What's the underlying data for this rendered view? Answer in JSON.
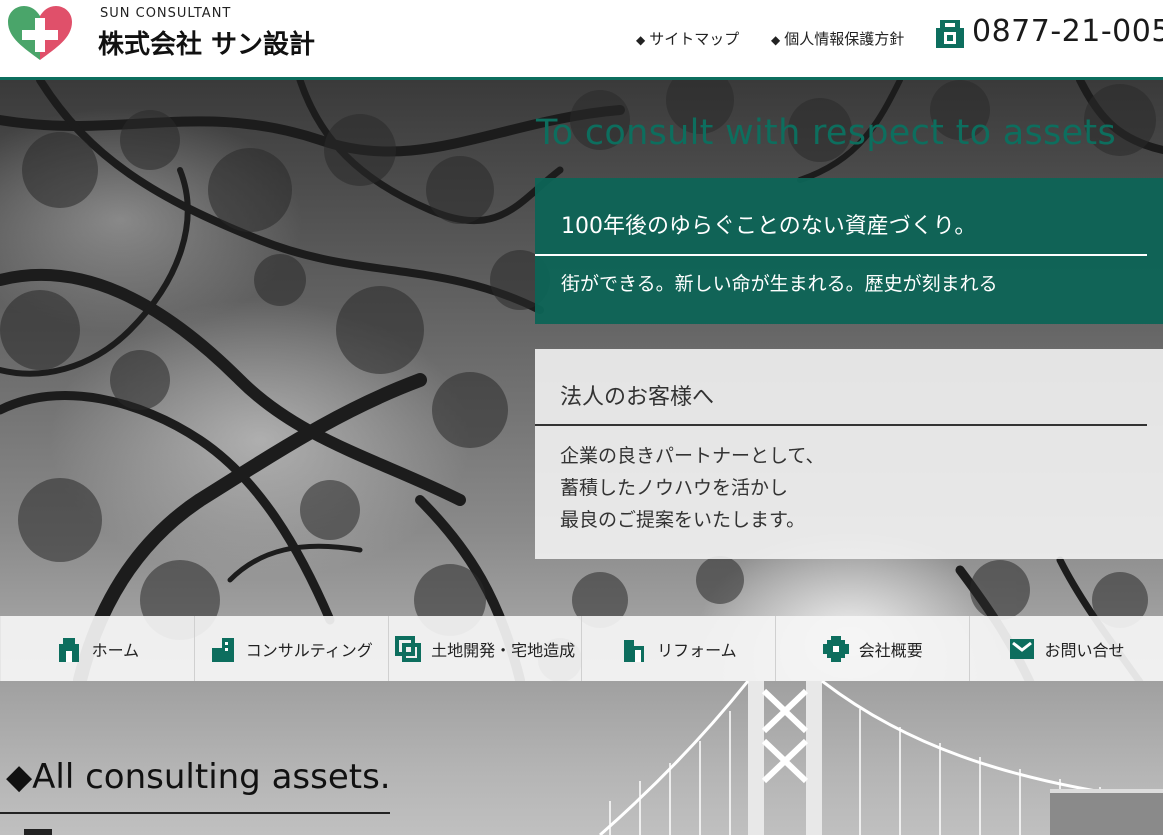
{
  "brand": {
    "company_en": "SUN CONSULTANT",
    "company_jp": "株式会社 サン設計",
    "colors": {
      "accent": "#0d6e5e",
      "logo_green": "#4aa56a",
      "logo_red": "#e0506a"
    }
  },
  "header": {
    "links": [
      {
        "label": "サイトマップ",
        "icon": "diamond-bullet"
      },
      {
        "label": "個人情報保護方針",
        "icon": "diamond-bullet"
      }
    ],
    "phone": {
      "icon": "phone-icon",
      "number": "0877-21-005"
    }
  },
  "hero": {
    "tagline": "To consult with respect to assets",
    "primary": {
      "headline": "100年後のゆらぐことのない資産づくり。",
      "subline": "街ができる。新しい命が生まれる。歴史が刻まれる"
    },
    "corporate": {
      "title": "法人のお客様へ",
      "lines": [
        "企業の良きパートナーとして、",
        "蓄積したノウハウを活かし",
        "最良のご提案をいたします。"
      ]
    }
  },
  "nav": {
    "items": [
      {
        "label": "ホーム",
        "icon": "home-icon"
      },
      {
        "label": "コンサルティング",
        "icon": "buildings-icon"
      },
      {
        "label": "土地開発・宅地造成",
        "icon": "land-icon"
      },
      {
        "label": "リフォーム",
        "icon": "house-icon"
      },
      {
        "label": "会社概要",
        "icon": "company-icon"
      },
      {
        "label": "お問い合せ",
        "icon": "mail-icon"
      }
    ]
  },
  "section": {
    "title": "◆All consulting assets."
  }
}
